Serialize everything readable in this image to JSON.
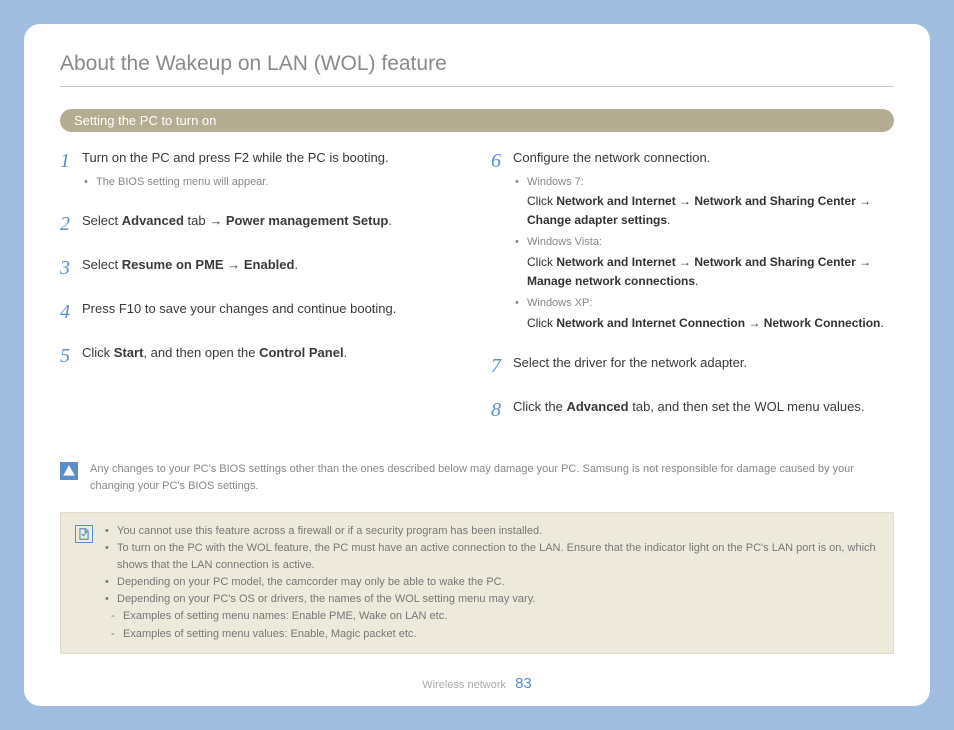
{
  "title": "About the Wakeup on LAN (WOL) feature",
  "sub_badge": "Setting the PC to turn on",
  "steps_left": [
    {
      "num": "1",
      "text_parts": [
        "Turn on the PC and press F2 while the PC is booting."
      ],
      "bullets": [
        "The BIOS setting menu will appear."
      ]
    },
    {
      "num": "2",
      "text_parts": [
        "Select ",
        "Advanced",
        " tab ",
        "→",
        " ",
        "Power management Setup",
        "."
      ]
    },
    {
      "num": "3",
      "text_parts": [
        "Select ",
        "Resume on PME",
        " ",
        "→",
        " ",
        "Enabled",
        "."
      ]
    },
    {
      "num": "4",
      "text_parts": [
        "Press F10 to save your changes and continue booting."
      ]
    },
    {
      "num": "5",
      "text_parts": [
        "Click ",
        "Start",
        ", and then open the ",
        "Control Panel",
        "."
      ]
    }
  ],
  "steps_right": [
    {
      "num": "6",
      "text_parts": [
        "Configure the network connection."
      ],
      "complex_bullets": [
        {
          "label": "Windows 7:",
          "line": [
            "Click ",
            "Network and Internet",
            " ",
            "→",
            " ",
            "Network and Sharing Center",
            " ",
            "→",
            " ",
            "Change adapter settings",
            "."
          ]
        },
        {
          "label": "Windows Vista:",
          "line": [
            "Click ",
            "Network and Internet",
            " ",
            "→",
            " ",
            "Network and Sharing Center",
            " ",
            "→",
            " ",
            "Manage network connections",
            "."
          ]
        },
        {
          "label": "Windows XP:",
          "line": [
            "Click ",
            "Network and Internet Connection",
            " ",
            "→",
            " ",
            "Network Connection",
            "."
          ]
        }
      ]
    },
    {
      "num": "7",
      "text_parts": [
        "Select the driver for the network adapter."
      ]
    },
    {
      "num": "8",
      "text_parts": [
        "Click the ",
        "Advanced",
        " tab, and then set the WOL menu values."
      ]
    }
  ],
  "warning": "Any changes to your PC's BIOS settings other than the ones described below may damage your PC. Samsung is not responsible for damage caused by your changing your PC's BIOS settings.",
  "notes": [
    "You cannot use this feature across a firewall or if a security program has been installed.",
    "To turn on the PC with the WOL feature, the PC must have an active connection to the LAN. Ensure that the indicator light on the PC's LAN port is on, which shows that the LAN connection is active.",
    "Depending on your PC model, the camcorder may only be able to wake the PC.",
    "Depending on your PC's OS or drivers, the names of the WOL setting menu may vary."
  ],
  "note_dashes": [
    "Examples of setting menu names: Enable PME, Wake on LAN etc.",
    "Examples of setting menu values: Enable, Magic packet etc."
  ],
  "footer_section": "Wireless network",
  "footer_page": "83"
}
